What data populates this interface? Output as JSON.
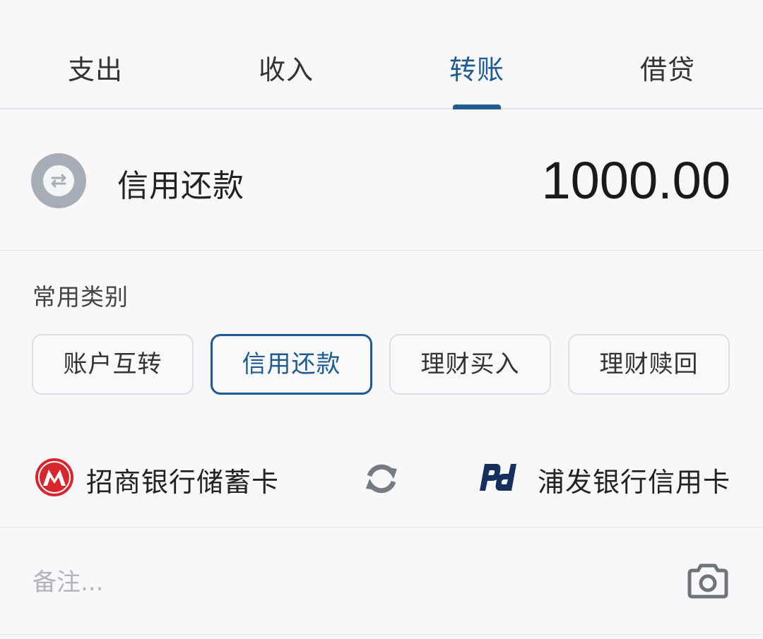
{
  "tabs": [
    {
      "label": "支出",
      "active": false
    },
    {
      "label": "收入",
      "active": false
    },
    {
      "label": "转账",
      "active": true
    },
    {
      "label": "借贷",
      "active": false
    }
  ],
  "transaction": {
    "category_icon": "transfer-arrows-icon",
    "category": "信用还款",
    "amount": "1000.00"
  },
  "common_categories": {
    "title": "常用类别",
    "items": [
      {
        "label": "账户互转",
        "selected": false
      },
      {
        "label": "信用还款",
        "selected": true
      },
      {
        "label": "理财买入",
        "selected": false
      },
      {
        "label": "理财赎回",
        "selected": false
      }
    ]
  },
  "accounts": {
    "from": {
      "label": "招商银行储蓄卡",
      "icon": "cmb-bank-logo-icon"
    },
    "swap_icon": "swap-refresh-icon",
    "to": {
      "label": "浦发银行信用卡",
      "icon": "spdb-bank-logo-icon"
    }
  },
  "note": {
    "placeholder": "备注...",
    "value": "",
    "icon": "camera-icon"
  },
  "colors": {
    "accent": "#1e5b94",
    "background": "#f8f8fb",
    "divider": "#e3e3e8",
    "cmb_red": "#d7262c",
    "spdb_navy": "#16305e"
  }
}
